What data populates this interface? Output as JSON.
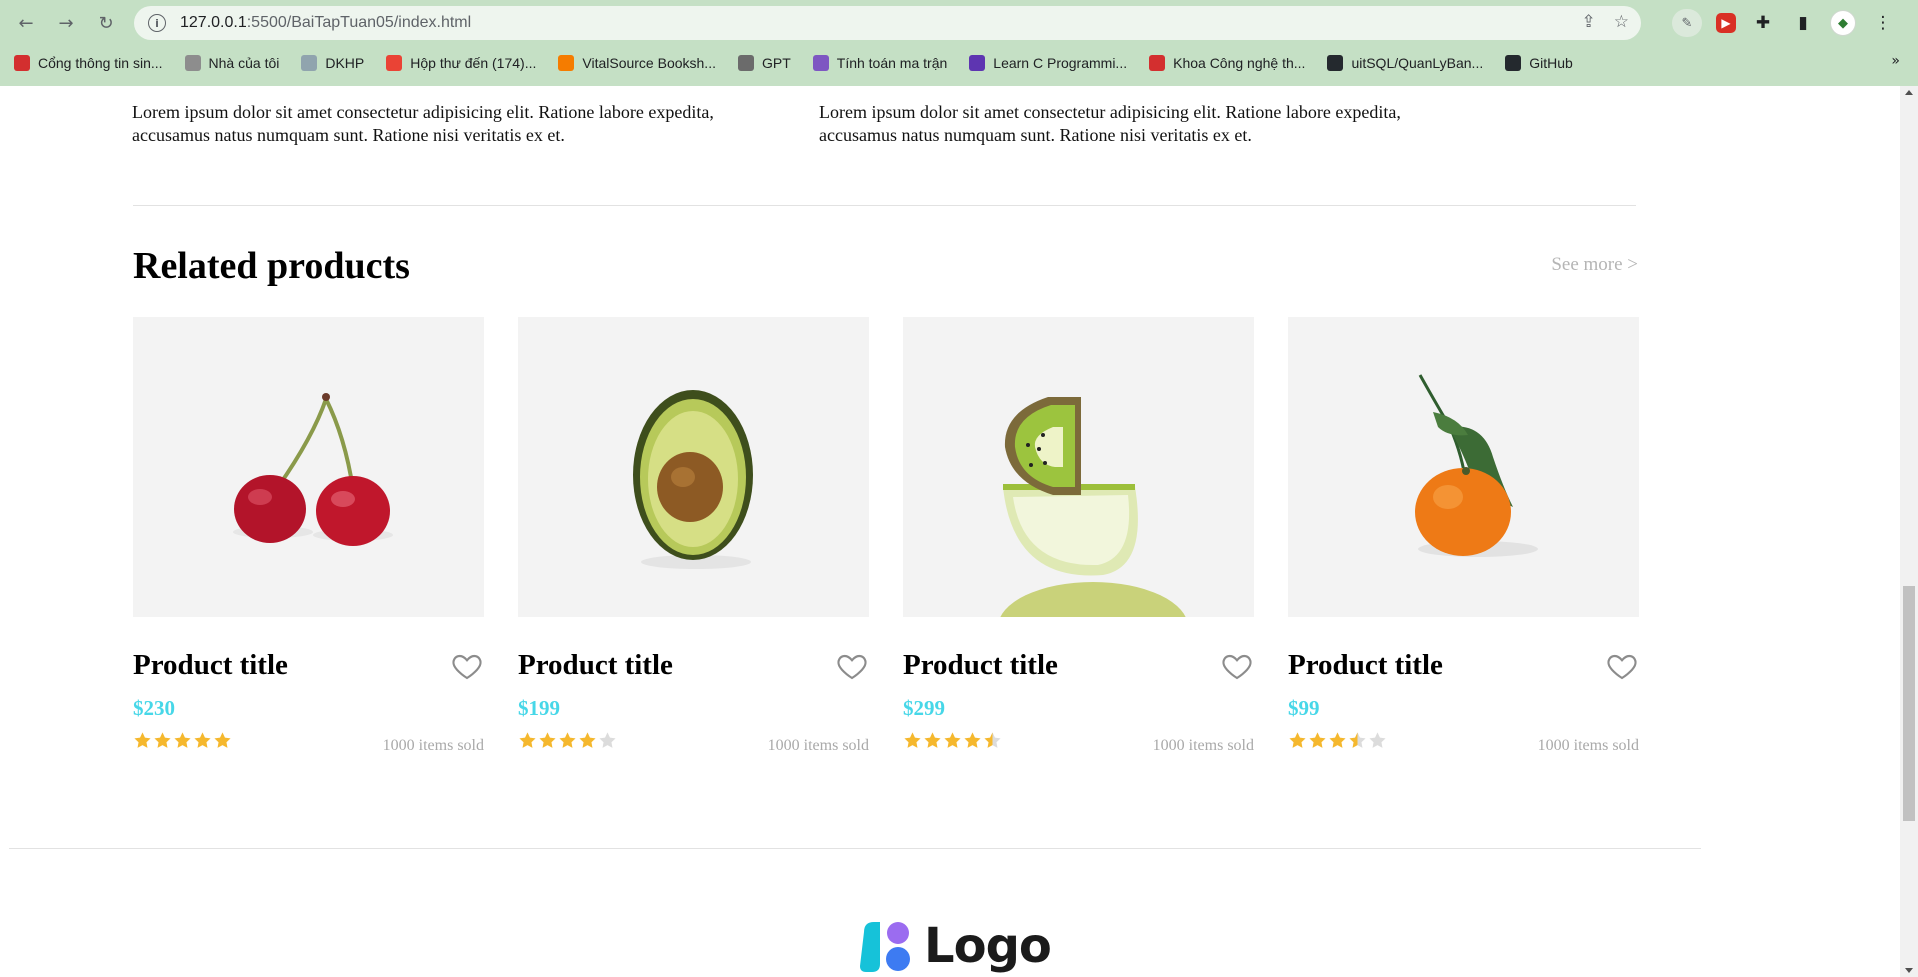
{
  "browser": {
    "url_host": "127.0.0.1",
    "url_path": ":5500/BaiTapTuan05/index.html",
    "bookmarks": [
      {
        "label": "Cổng thông tin sin...",
        "icon": "uit-icon",
        "color": "#d32f2f"
      },
      {
        "label": "Nhà của tôi",
        "icon": "home-page-icon",
        "color": "#8d8d8d"
      },
      {
        "label": "DKHP",
        "icon": "document-icon",
        "color": "#90a4ae"
      },
      {
        "label": "Hộp thư đến (174)...",
        "icon": "gmail-icon",
        "color": "#ea4335"
      },
      {
        "label": "VitalSource Booksh...",
        "icon": "bookmark-icon",
        "color": "#f57c00"
      },
      {
        "label": "GPT",
        "icon": "chatgpt-icon",
        "color": "#6b6b6b"
      },
      {
        "label": "Tính toán ma trận",
        "icon": "matrix-icon",
        "color": "#7e57c2"
      },
      {
        "label": "Learn C Programmi...",
        "icon": "programiz-icon",
        "color": "#5e35b1"
      },
      {
        "label": "Khoa Công nghệ th...",
        "icon": "uit-icon",
        "color": "#d32f2f"
      },
      {
        "label": "uitSQL/QuanLyBan...",
        "icon": "github-icon",
        "color": "#24292e"
      },
      {
        "label": "GitHub",
        "icon": "github-icon",
        "color": "#24292e"
      }
    ],
    "more_label": "»"
  },
  "page": {
    "lorem_left": "Lorem ipsum dolor sit amet consectetur adipisicing elit. Ratione labore expedita, accusamus natus numquam sunt. Ratione nisi veritatis ex et.",
    "lorem_right": "Lorem ipsum dolor sit amet consectetur adipisicing elit. Ratione labore expedita, accusamus natus numquam sunt. Ratione nisi veritatis ex et.",
    "section_title": "Related products",
    "see_more": "See more >",
    "products": [
      {
        "title": "Product title",
        "price": "$230",
        "rating": 5,
        "sold": "1000 items sold",
        "image": "cherries"
      },
      {
        "title": "Product title",
        "price": "$199",
        "rating": 4,
        "sold": "1000 items sold",
        "image": "avocado"
      },
      {
        "title": "Product title",
        "price": "$299",
        "rating": 4.5,
        "sold": "1000 items sold",
        "image": "kiwi-lime"
      },
      {
        "title": "Product title",
        "price": "$99",
        "rating": 3.5,
        "sold": "1000 items sold",
        "image": "tangerine"
      }
    ],
    "footer_logo": "Logo",
    "colors": {
      "price": "#47d7e8",
      "star": "#f5b82e",
      "star_empty": "#dcdcdc"
    }
  }
}
